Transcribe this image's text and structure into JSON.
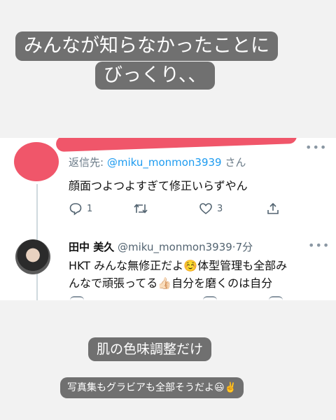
{
  "captions": {
    "top_line1": "みんなが知らなかったことに",
    "top_line2": "びっくり、、",
    "bottom_main": "肌の色味調整だけ",
    "bottom_sub": "写真集もグラビアも全部そうだよ😃✌️"
  },
  "reply_tweet": {
    "reply_to_label": "返信先: ",
    "reply_to_handle": "@miku_monmon3939",
    "reply_to_suffix": " さん",
    "text": "顔面つよつよすぎて修正いらずやん",
    "reply_count": "1",
    "like_count": "3"
  },
  "main_tweet": {
    "display_name": "田中 美久",
    "handle": "@miku_monmon3939",
    "time": "·7分",
    "text_line1": "HKT みんな無修正だよ☺️体型管理も全部み",
    "text_line2": "んなで頑張ってる👍🏻自分を磨くのは自分"
  },
  "icons": {
    "reply": "reply-icon",
    "retweet": "retweet-icon",
    "like": "heart-icon",
    "share": "share-icon",
    "more": "more-icon"
  },
  "colors": {
    "caption_bg": "#707070",
    "redaction": "#f0566a",
    "link": "#1d9bf0"
  }
}
